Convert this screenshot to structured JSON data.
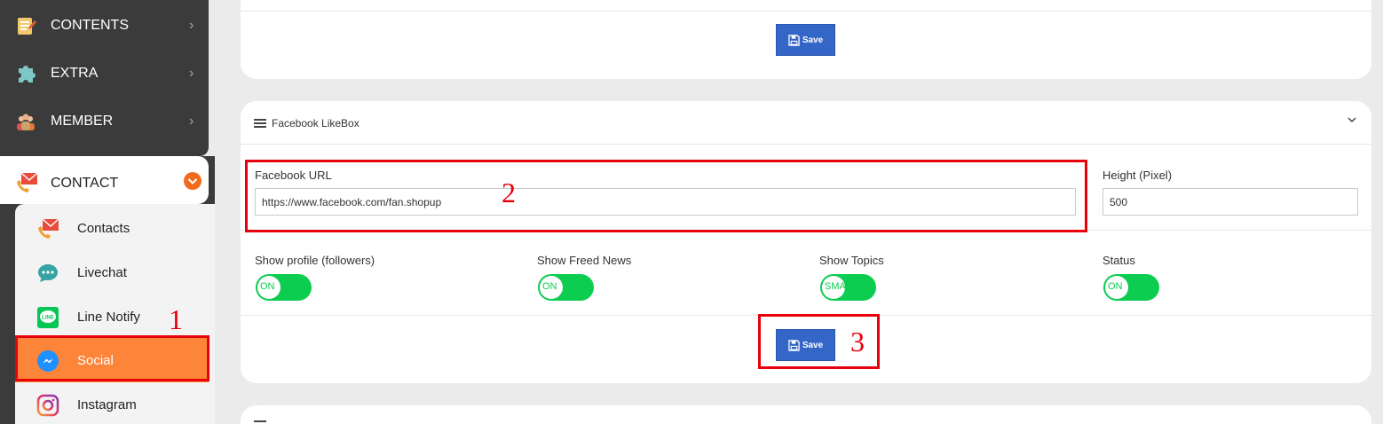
{
  "sidebar": {
    "top_items": [
      {
        "label": "CONTENTS",
        "icon": "contents-icon"
      },
      {
        "label": "EXTRA",
        "icon": "puzzle-icon"
      },
      {
        "label": "MEMBER",
        "icon": "member-icon"
      }
    ],
    "contact": {
      "label": "CONTACT",
      "icon": "contact-icon"
    },
    "sub_items": [
      {
        "label": "Contacts",
        "icon": "contacts-icon"
      },
      {
        "label": "Livechat",
        "icon": "livechat-icon"
      },
      {
        "label": "Line Notify",
        "icon": "line-icon"
      },
      {
        "label": "Social",
        "icon": "messenger-icon"
      },
      {
        "label": "Instagram",
        "icon": "instagram-icon"
      }
    ]
  },
  "card_top": {
    "save_label": "Save"
  },
  "facebook_likebox": {
    "title": "Facebook LikeBox",
    "facebook_url_label": "Facebook URL",
    "facebook_url_value": "https://www.facebook.com/fan.shopup",
    "height_label": "Height (Pixel)",
    "height_value": "500",
    "toggles": [
      {
        "label": "Show profile (followers)",
        "state": "ON"
      },
      {
        "label": "Show Freed News",
        "state": "ON"
      },
      {
        "label": "Show Topics",
        "state": "SMALL"
      },
      {
        "label": "Status",
        "state": "ON"
      }
    ],
    "save_label": "Save"
  },
  "annotations": [
    "1",
    "2",
    "3"
  ],
  "colors": {
    "sidebar_dark": "#3b3b3b",
    "active_item": "#fd853a",
    "save_button": "#3466c8",
    "toggle_on": "#0ccd50",
    "annotation_red": "#e8000b"
  }
}
